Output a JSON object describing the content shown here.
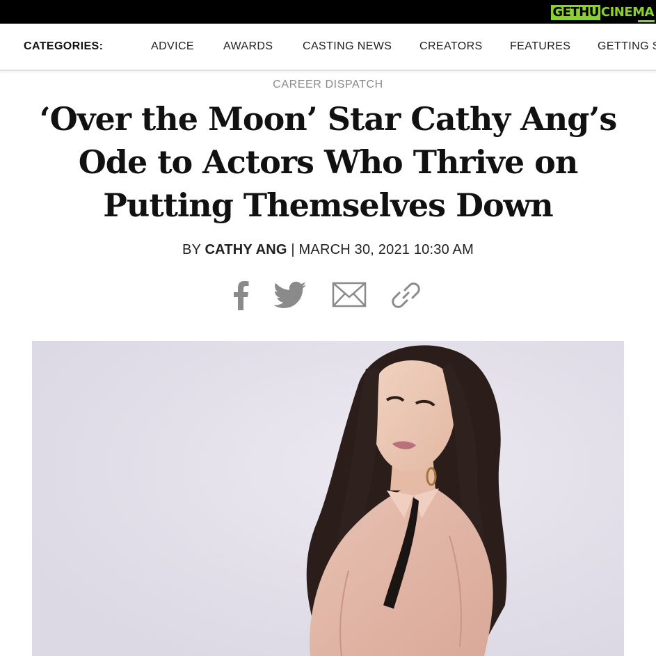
{
  "logo": {
    "left": "GETHU",
    "right": "CINEMA",
    "brand_color": "#8bd12c"
  },
  "nav": {
    "label": "CATEGORIES:",
    "items": [
      "ADVICE",
      "AWARDS",
      "CASTING NEWS",
      "CREATORS",
      "FEATURES",
      "GETTING S"
    ]
  },
  "article": {
    "kicker": "CAREER DISPATCH",
    "headline": {
      "line1": "‘Over the Moon’ Star Cathy Ang’s",
      "line2": "Ode to Actors Who Thrive on",
      "line3": "Putting Themselves Down"
    },
    "byline": {
      "prefix": "BY ",
      "author": "CATHY ANG",
      "separator": " | ",
      "date": "MARCH 30, 2021 10:30 AM"
    }
  },
  "share": {
    "icons": [
      "facebook-icon",
      "twitter-icon",
      "email-icon",
      "link-icon"
    ],
    "icon_color": "#8a8a8a"
  },
  "hero_image": {
    "subject": "portrait photo",
    "background_color": "#e5e2ec"
  }
}
